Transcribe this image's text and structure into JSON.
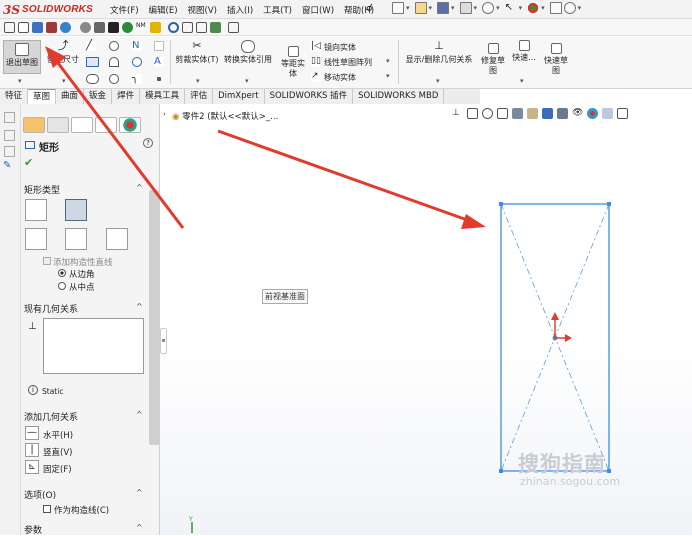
{
  "app": {
    "logo_ds": "3S",
    "logo_name": "SOLIDWORKS"
  },
  "menubar": [
    "文件(F)",
    "编辑(E)",
    "视图(V)",
    "插入(I)",
    "工具(T)",
    "窗口(W)",
    "帮助(H)"
  ],
  "ribbon": {
    "exit_sketch": "退出草图",
    "smart_dim": "智能尺寸",
    "trim": "剪裁实体(T)",
    "convert": "转换实体引用",
    "offset_line1": "等距实",
    "offset_line2": "体",
    "mirror": "镜向实体",
    "linear_pattern": "线性草图阵列",
    "move": "移动实体",
    "display_delete": "显示/删除几何关系",
    "repair_line1": "修复草",
    "repair_line2": "图",
    "quick_snap": "快速...",
    "quick_sketch_line1": "快速草",
    "quick_sketch_line2": "图"
  },
  "tabs": [
    "特征",
    "草图",
    "曲面",
    "钣金",
    "焊件",
    "模具工具",
    "评估",
    "DimXpert",
    "SOLIDWORKS 插件",
    "SOLIDWORKS MBD"
  ],
  "property_manager": {
    "title": "矩形",
    "help": "?",
    "rect_type_header": "矩形类型",
    "add_construction": "添加构造性直线",
    "from_corner": "从边角",
    "from_midpoint": "从中点",
    "existing_relations_header": "现有几何关系",
    "static_label": "Static",
    "add_relations_header": "添加几何关系",
    "horizontal": "水平(H)",
    "vertical": "竖直(V)",
    "fix": "固定(F)",
    "options_header": "选项(O)",
    "as_construction": "作为构造线(C)",
    "params_header": "参数"
  },
  "canvas": {
    "tree_head": "零件2 (默认<<默认>_...",
    "plane_label": "前视基准面"
  },
  "watermark": {
    "text": "搜狗指南",
    "url": "zhinan.sogou.com"
  },
  "colors": {
    "accent": "#d3261c",
    "sketch_line": "#3b8ee8",
    "arrow": "#e23b2e"
  }
}
